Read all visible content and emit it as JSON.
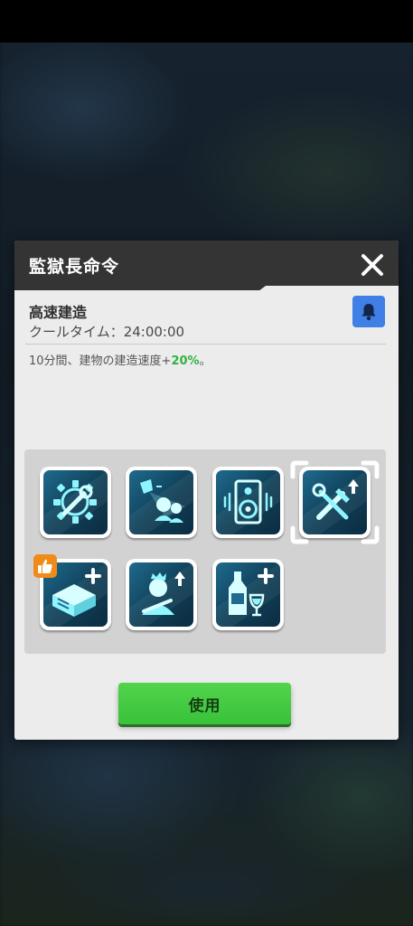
{
  "dialog": {
    "title": "監獄長命令",
    "close_icon": "close-icon"
  },
  "item": {
    "name": "高速建造",
    "cooltime": "クールタイム：24:00:00",
    "desc_prefix": "10分間、建物の建造速度+",
    "desc_value": "20%",
    "desc_suffix": "。",
    "bell_icon": "bell-icon"
  },
  "orders": [
    {
      "icon": "gear-wrench-icon",
      "selected": false,
      "recommended": false
    },
    {
      "icon": "spotlight-prisoners-icon",
      "selected": false,
      "recommended": false
    },
    {
      "icon": "speaker-icon",
      "selected": false,
      "recommended": false
    },
    {
      "icon": "tools-upgrade-icon",
      "selected": true,
      "recommended": false
    },
    {
      "icon": "build-plus-icon",
      "selected": false,
      "recommended": true
    },
    {
      "icon": "prisoner-upgrade-icon",
      "selected": false,
      "recommended": false
    },
    {
      "icon": "wine-plus-icon",
      "selected": false,
      "recommended": false
    }
  ],
  "use_button": {
    "label": "使用"
  },
  "colors": {
    "header": "#343434",
    "panel": "#ececec",
    "accent_green": "#31b340",
    "button_green": "#45c83f",
    "bell_blue": "#3f7fe6",
    "icon_glow": "#7ff2ff"
  }
}
